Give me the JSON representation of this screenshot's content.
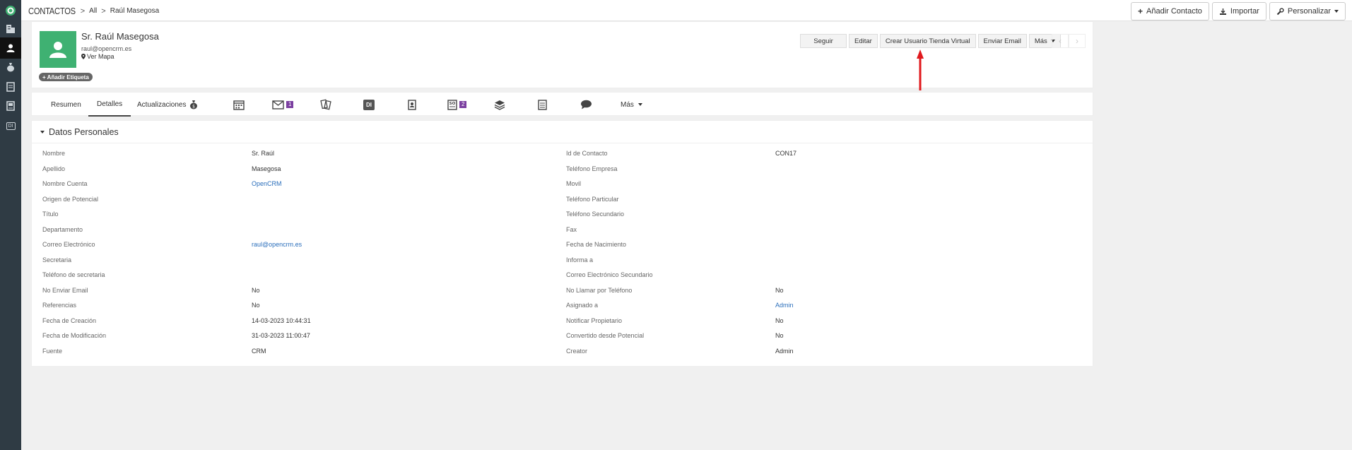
{
  "sidebar": {
    "items": [
      {
        "icon": "logo-icon"
      },
      {
        "icon": "building-icon"
      },
      {
        "icon": "contact-icon",
        "active": true
      },
      {
        "icon": "money-bag-icon"
      },
      {
        "icon": "document-icon"
      },
      {
        "icon": "id-card-icon"
      },
      {
        "icon": "di-icon",
        "label": "DI"
      }
    ]
  },
  "breadcrumb": {
    "module": "CONTACTOS",
    "separator": ">",
    "items": [
      "All",
      "Raúl Masegosa"
    ]
  },
  "top_actions": {
    "add_contact": "Añadir Contacto",
    "import": "Importar",
    "customize": "Personalizar"
  },
  "contact": {
    "name": "Sr. Raúl Masegosa",
    "email": "raul@opencrm.es",
    "map_link": "Ver Mapa",
    "add_tag": "Añadir Etiqueta"
  },
  "record_actions": {
    "follow": "Seguir",
    "edit": "Editar",
    "create_store_user": "Crear Usuario Tienda Virtual",
    "send_email": "Enviar Email",
    "more": "Más"
  },
  "tabs": {
    "summary": "Resumen",
    "details": "Detalles",
    "updates": "Actualizaciones",
    "di_label": "DI",
    "email_badge": "1",
    "sales_badge": "2",
    "more": "Más"
  },
  "section": {
    "title": "Datos Personales"
  },
  "fields_left": [
    {
      "label": "Nombre",
      "value": "Sr. Raúl",
      "link": false
    },
    {
      "label": "Apellido",
      "value": "Masegosa",
      "link": false
    },
    {
      "label": "Nombre Cuenta",
      "value": "OpenCRM",
      "link": true
    },
    {
      "label": "Origen de Potencial",
      "value": "",
      "link": false
    },
    {
      "label": "Título",
      "value": "",
      "link": false
    },
    {
      "label": "Departamento",
      "value": "",
      "link": false
    },
    {
      "label": "Correo Electrónico",
      "value": "raul@opencrm.es",
      "link": true
    },
    {
      "label": "Secretaria",
      "value": "",
      "link": false
    },
    {
      "label": "Teléfono de secretaria",
      "value": "",
      "link": false
    },
    {
      "label": "No Enviar Email",
      "value": "No",
      "link": false
    },
    {
      "label": "Referencias",
      "value": "No",
      "link": false
    },
    {
      "label": "Fecha de Creación",
      "value": "14-03-2023 10:44:31",
      "link": false
    },
    {
      "label": "Fecha de Modificación",
      "value": "31-03-2023 11:00:47",
      "link": false
    },
    {
      "label": "Fuente",
      "value": "CRM",
      "link": false
    }
  ],
  "fields_right": [
    {
      "label": "Id de Contacto",
      "value": "CON17",
      "link": false
    },
    {
      "label": "Teléfono Empresa",
      "value": "",
      "link": false
    },
    {
      "label": "Movil",
      "value": "",
      "link": false
    },
    {
      "label": "Teléfono Particular",
      "value": "",
      "link": false
    },
    {
      "label": "Teléfono Secundario",
      "value": "",
      "link": false
    },
    {
      "label": "Fax",
      "value": "",
      "link": false
    },
    {
      "label": "Fecha de Nacimiento",
      "value": "",
      "link": false
    },
    {
      "label": "Informa a",
      "value": "",
      "link": false
    },
    {
      "label": "Correo Electrónico Secundario",
      "value": "",
      "link": false
    },
    {
      "label": "No Llamar por Teléfono",
      "value": "No",
      "link": false
    },
    {
      "label": "Asignado a",
      "value": "Admin",
      "link": true
    },
    {
      "label": "Notificar Propietario",
      "value": "No",
      "link": false
    },
    {
      "label": "Convertido desde Potencial",
      "value": "No",
      "link": false
    },
    {
      "label": "Creator",
      "value": "Admin",
      "link": false
    }
  ],
  "colors": {
    "sidebar": "#2f3b44",
    "avatar": "#3fb172",
    "link": "#2a6ebb",
    "badge": "#7b3fa0",
    "annotation": "#e0191d"
  }
}
